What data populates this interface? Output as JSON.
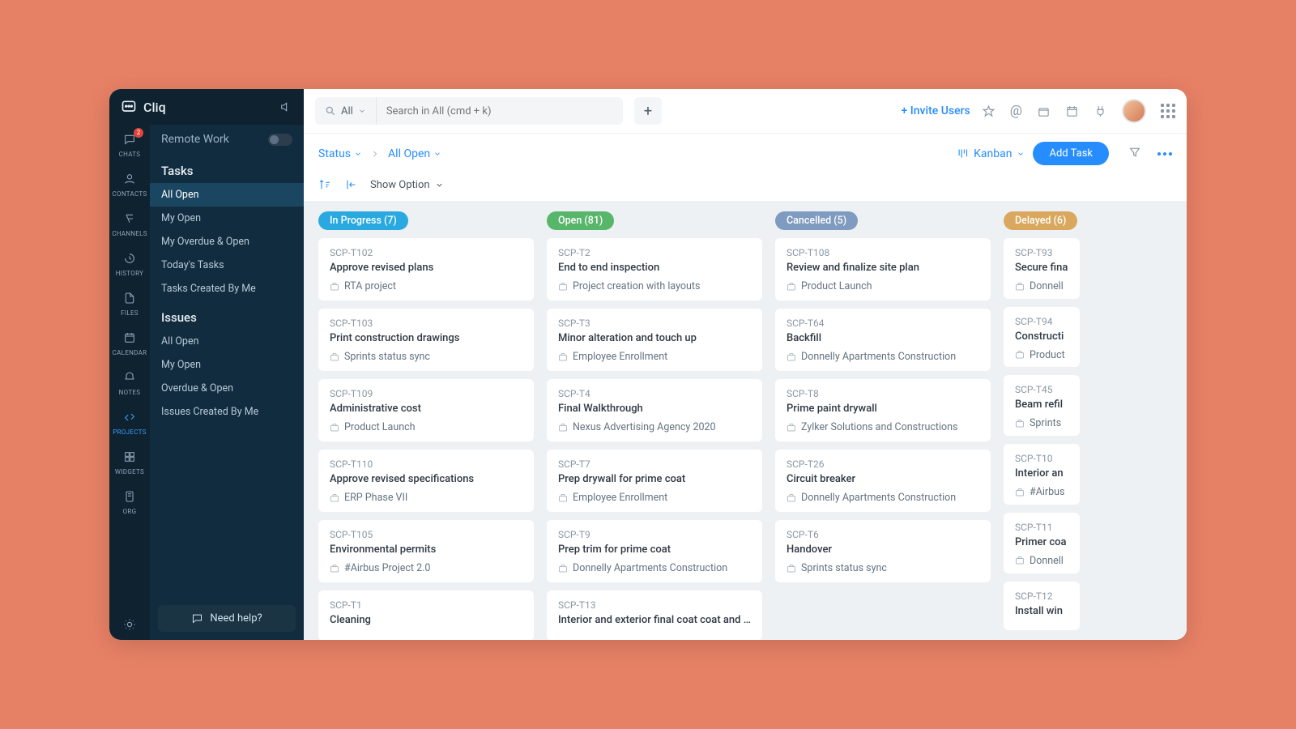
{
  "brand": {
    "name": "Cliq",
    "remote_label": "Remote Work"
  },
  "rail": {
    "items": [
      {
        "label": "CHATS",
        "badge": "2"
      },
      {
        "label": "CONTACTS"
      },
      {
        "label": "CHANNELS"
      },
      {
        "label": "HISTORY"
      },
      {
        "label": "FILES"
      },
      {
        "label": "CALENDAR"
      },
      {
        "label": "NOTES"
      },
      {
        "label": "PROJECTS",
        "active": true
      },
      {
        "label": "WIDGETS"
      },
      {
        "label": "ORG"
      }
    ]
  },
  "sidebar": {
    "tasks_title": "Tasks",
    "tasks": [
      "All Open",
      "My Open",
      "My Overdue & Open",
      "Today's Tasks",
      "Tasks Created By Me"
    ],
    "issues_title": "Issues",
    "issues": [
      "All Open",
      "My Open",
      "Overdue & Open",
      "Issues Created By Me"
    ],
    "help": "Need help?"
  },
  "topbar": {
    "scope": "All",
    "search_placeholder": "Search in All (cmd + k)",
    "invite": "+ Invite Users"
  },
  "breadcrumb": {
    "status": "Status",
    "allopen": "All Open"
  },
  "toolbar": {
    "kanban": "Kanban",
    "addtask": "Add Task",
    "showopt": "Show Option"
  },
  "columns": [
    {
      "label": "In Progress (7)",
      "color": "#2aa9e0",
      "cards": [
        {
          "id": "SCP-T102",
          "title": "Approve revised plans",
          "tag": "RTA project"
        },
        {
          "id": "SCP-T103",
          "title": "Print construction drawings",
          "tag": "Sprints status sync"
        },
        {
          "id": "SCP-T109",
          "title": "Administrative cost",
          "tag": "Product Launch"
        },
        {
          "id": "SCP-T110",
          "title": "Approve revised specifications",
          "tag": "ERP Phase VII"
        },
        {
          "id": "SCP-T105",
          "title": "Environmental permits",
          "tag": "#Airbus Project 2.0"
        },
        {
          "id": "SCP-T1",
          "title": "Cleaning",
          "tag": ""
        }
      ]
    },
    {
      "label": "Open (81)",
      "color": "#57b66a",
      "cards": [
        {
          "id": "SCP-T2",
          "title": "End to end inspection",
          "tag": "Project creation with layouts"
        },
        {
          "id": "SCP-T3",
          "title": "Minor alteration and touch up",
          "tag": "Employee Enrollment"
        },
        {
          "id": "SCP-T4",
          "title": "Final Walkthrough",
          "tag": "Nexus Advertising Agency 2020"
        },
        {
          "id": "SCP-T7",
          "title": "Prep drywall for prime coat",
          "tag": "Employee Enrollment"
        },
        {
          "id": "SCP-T9",
          "title": "Prep trim for prime coat",
          "tag": "Donnelly Apartments Construction"
        },
        {
          "id": "SCP-T13",
          "title": "Interior and exterior final coat coat and touch up",
          "tag": ""
        }
      ]
    },
    {
      "label": "Cancelled (5)",
      "color": "#7f9bbf",
      "cards": [
        {
          "id": "SCP-T108",
          "title": "Review and finalize site plan",
          "tag": "Product Launch"
        },
        {
          "id": "SCP-T64",
          "title": "Backfill",
          "tag": "Donnelly Apartments Construction"
        },
        {
          "id": "SCP-T8",
          "title": "Prime paint drywall",
          "tag": "Zylker Solutions and Constructions"
        },
        {
          "id": "SCP-T26",
          "title": "Circuit breaker",
          "tag": "Donnelly Apartments Construction"
        },
        {
          "id": "SCP-T6",
          "title": "Handover",
          "tag": "Sprints status sync"
        }
      ]
    },
    {
      "label": "Delayed (6)",
      "color": "#d9a85e",
      "cards": [
        {
          "id": "SCP-T93",
          "title": "Secure fina",
          "tag": "Donnell"
        },
        {
          "id": "SCP-T94",
          "title": "Constructi",
          "tag": "Product"
        },
        {
          "id": "SCP-T45",
          "title": "Beam refil",
          "tag": "Sprints"
        },
        {
          "id": "SCP-T10",
          "title": "Interior an",
          "tag": "#Airbus"
        },
        {
          "id": "SCP-T11",
          "title": "Primer coa",
          "tag": "Donnell"
        },
        {
          "id": "SCP-T12",
          "title": "Install win",
          "tag": ""
        }
      ]
    }
  ]
}
